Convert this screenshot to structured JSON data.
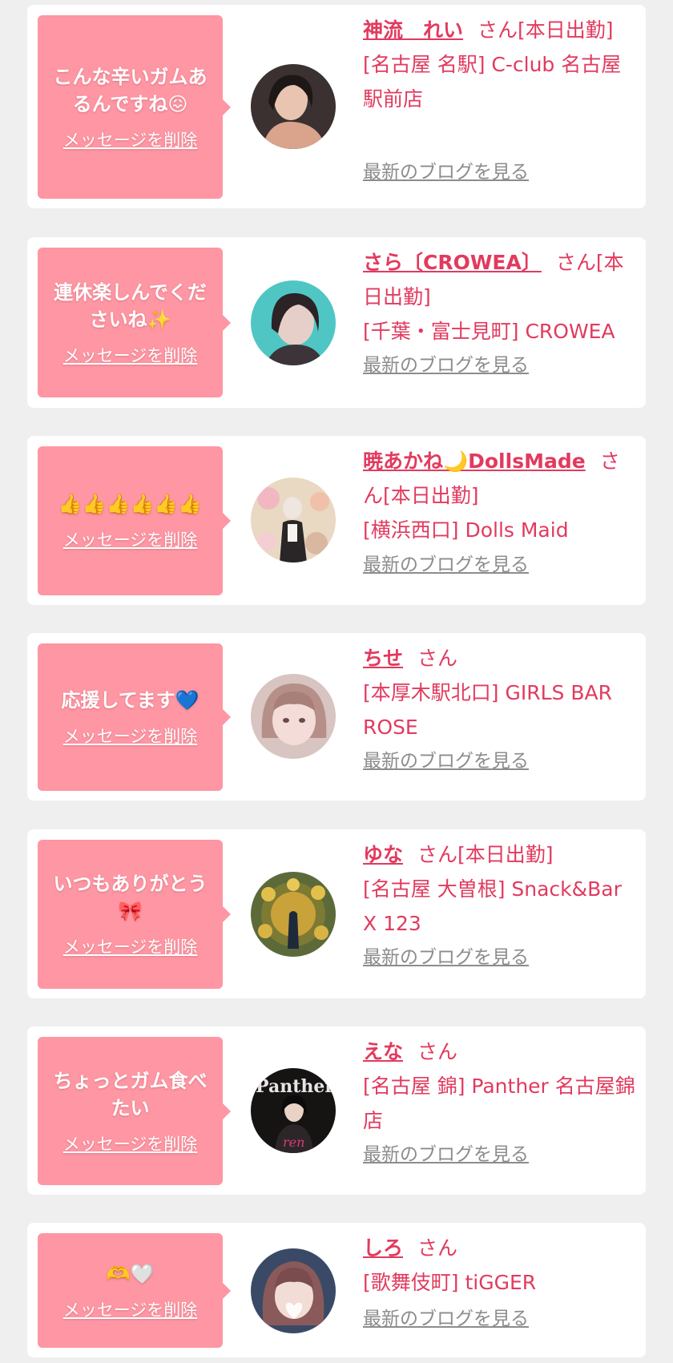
{
  "delete_label": "メッセージを削除",
  "blog_label": "最新のブログを見る",
  "colors": {
    "background": "#efefef",
    "card": "#ffffff",
    "bubble": "#fe96a3",
    "name_text": "#e23a5e",
    "blog_link": "#8c8c8c"
  },
  "messages": [
    {
      "message": "こんな辛いガムあるんですね😖",
      "cast_name": "神流　れい",
      "suffix": "さん[本日出勤]",
      "shop": "[名古屋 名駅] C-club 名古屋駅前店",
      "avatar_icon": "cast-photo-icon"
    },
    {
      "message": "連休楽しんでくださいね✨",
      "cast_name": "さら〔CROWEA〕",
      "suffix": "さん[本日出勤]",
      "shop": "[千葉・富士見町] CROWEA",
      "avatar_icon": "cast-photo-icon"
    },
    {
      "message": "👍👍👍👍👍👍",
      "cast_name": "暁あかね🌙DollsMade",
      "suffix": "さん[本日出勤]",
      "shop": "[横浜西口] Dolls Maid",
      "avatar_icon": "cast-photo-icon"
    },
    {
      "message": "応援してます💙",
      "cast_name": "ちせ",
      "suffix": "さん",
      "shop": "[本厚木駅北口] GIRLS BAR ROSE",
      "avatar_icon": "cast-photo-icon"
    },
    {
      "message": "いつもありがとう🎀",
      "cast_name": "ゆな",
      "suffix": "さん[本日出勤]",
      "shop": "[名古屋 大曽根] Snack&Bar X 123",
      "avatar_icon": "cast-photo-icon"
    },
    {
      "message": "ちょっとガム食べたい",
      "cast_name": "えな",
      "suffix": "さん",
      "shop": "[名古屋 錦] Panther 名古屋錦店",
      "avatar_icon": "cast-photo-icon"
    },
    {
      "message": "🫶🤍",
      "cast_name": "しろ",
      "suffix": "さん",
      "shop": "[歌舞伎町] tiGGER",
      "avatar_icon": "cast-photo-icon"
    }
  ]
}
